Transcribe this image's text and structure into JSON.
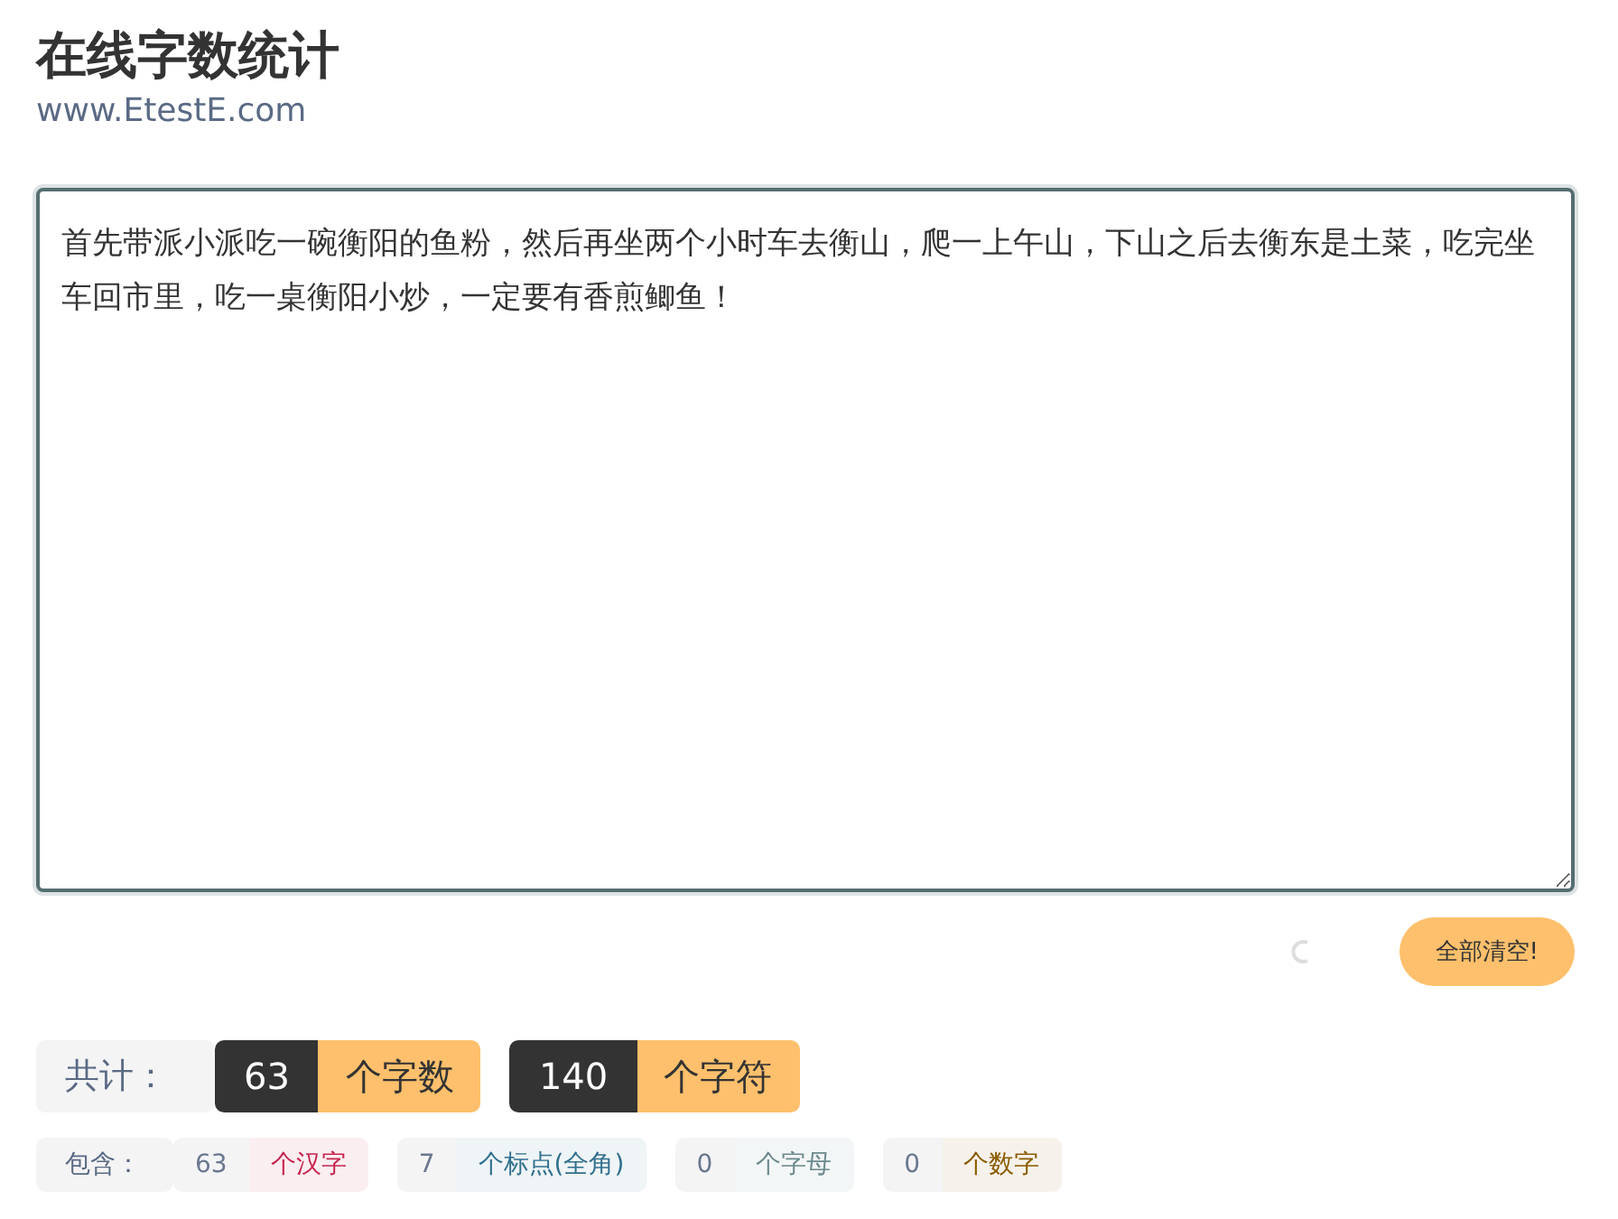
{
  "title": "在线字数统计",
  "subtitle": "www.EtestE.com",
  "editor": {
    "value": "首先带派小派吃一碗衡阳的鱼粉，然后再坐两个小时车去衡山，爬一上午山，下山之后去衡东是土菜，吃完坐车回市里，吃一桌衡阳小炒，一定要有香煎鲫鱼！"
  },
  "clear_button": "全部清空!",
  "totals": {
    "label": "共计：",
    "items": [
      {
        "count": "63",
        "unit": "个字数"
      },
      {
        "count": "140",
        "unit": "个字符"
      }
    ]
  },
  "breakdown": {
    "label": "包含：",
    "items": [
      {
        "count": "63",
        "unit": "个汉字",
        "color": "#c7254e"
      },
      {
        "count": "7",
        "unit": "个标点(全角)",
        "color": "#31708f"
      },
      {
        "count": "0",
        "unit": "个字母",
        "color": "#6c8a8e"
      },
      {
        "count": "0",
        "unit": "个数字",
        "color": "#8a5a00"
      }
    ]
  }
}
